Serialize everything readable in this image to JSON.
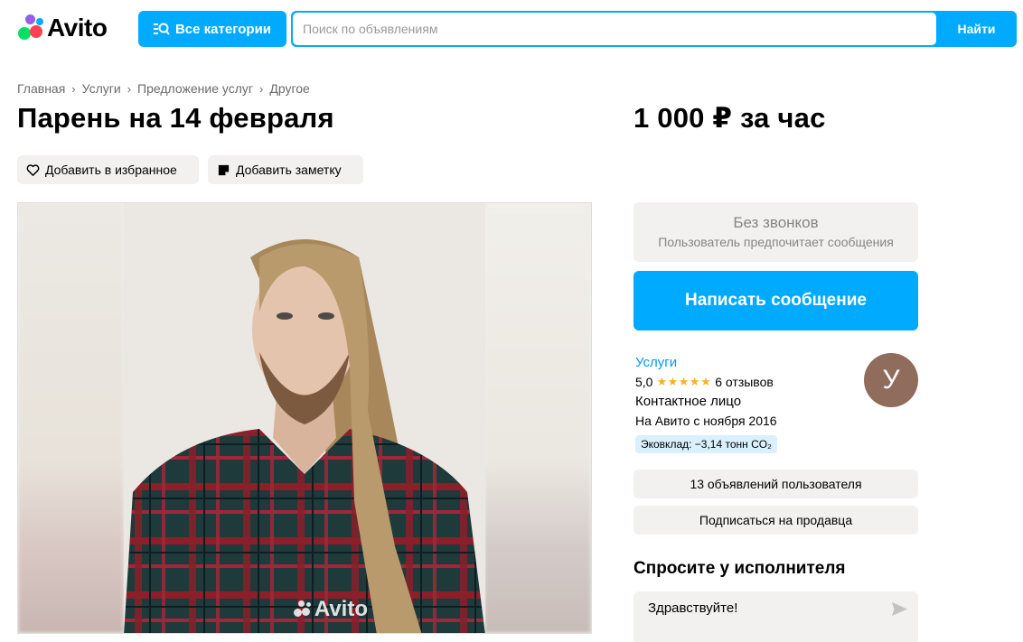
{
  "header": {
    "logo_text": "Avito",
    "categories_label": "Все категории",
    "search_placeholder": "Поиск по объявлениям",
    "search_button": "Найти"
  },
  "breadcrumb": [
    "Главная",
    "Услуги",
    "Предложение услуг",
    "Другое"
  ],
  "listing": {
    "title": "Парень на 14 февраля",
    "price": "1 000 ₽ за час",
    "favorite_label": "Добавить в избранное",
    "note_label": "Добавить заметку",
    "photo_watermark": "Avito"
  },
  "contact": {
    "no_calls_title": "Без звонков",
    "no_calls_subtitle": "Пользователь предпочитает сообщения",
    "write_button": "Написать сообщение"
  },
  "seller": {
    "category": "Услуги",
    "rating": "5,0",
    "stars": "★★★★★",
    "reviews": "6 отзывов",
    "contact_type": "Контактное лицо",
    "since": "На Авито с ноября 2016",
    "eco": "Эковклад: −3,14 тонн CO₂",
    "avatar_letter": "У",
    "ads_button": "13 объявлений пользователя",
    "subscribe_button": "Подписаться на продавца"
  },
  "ask": {
    "title": "Спросите у исполнителя",
    "message": "Здравствуйте!"
  },
  "colors": {
    "accent": "#00aaff",
    "pill_bg": "#f2f1f0",
    "star": "#ffb021",
    "avatar_bg": "#8f6c5c"
  }
}
